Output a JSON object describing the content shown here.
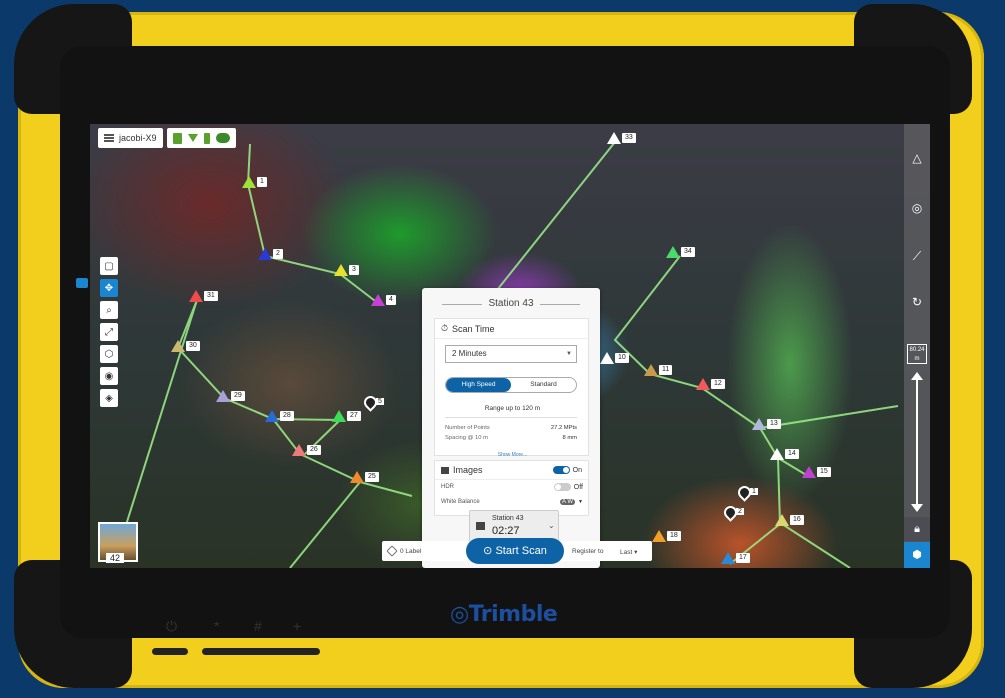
{
  "header": {
    "device_name": "jacobi-X9"
  },
  "map": {
    "stations": [
      {
        "id": "1",
        "color": "#9be33a"
      },
      {
        "id": "2",
        "color": "#2a3ad8"
      },
      {
        "id": "3",
        "color": "#e8e030"
      },
      {
        "id": "4",
        "color": "#c640d6"
      },
      {
        "id": "31",
        "color": "#f04a4a"
      },
      {
        "id": "30",
        "color": "#c8b870"
      },
      {
        "id": "29",
        "color": "#a8a0d8"
      },
      {
        "id": "28",
        "color": "#2a6ad8"
      },
      {
        "id": "27",
        "color": "#3adc5a"
      },
      {
        "id": "26",
        "color": "#f07a7a"
      },
      {
        "id": "25",
        "color": "#f08a2a"
      },
      {
        "id": "33",
        "color": "#ffffff"
      },
      {
        "id": "34",
        "color": "#4adc6a"
      },
      {
        "id": "10",
        "color": "#ffffff"
      },
      {
        "id": "11",
        "color": "#c89a4a"
      },
      {
        "id": "12",
        "color": "#f05a5a"
      },
      {
        "id": "13",
        "color": "#b0b8d8"
      },
      {
        "id": "14",
        "color": "#ffffff"
      },
      {
        "id": "15",
        "color": "#c040d0"
      },
      {
        "id": "16",
        "color": "#d8d870"
      },
      {
        "id": "17",
        "color": "#2a8ad8"
      },
      {
        "id": "18",
        "color": "#f0a02a"
      }
    ],
    "pins": [
      {
        "id": "5"
      },
      {
        "id": "1"
      },
      {
        "id": "2"
      }
    ],
    "thumbnail_station": "42"
  },
  "scan_card": {
    "title": "Station 43",
    "scan_time_label": "Scan Time",
    "scan_time_value": "2 Minutes",
    "mode_high": "High Speed",
    "mode_standard": "Standard",
    "range_text": "Range up to 120 m",
    "num_points_label": "Number of Points",
    "num_points_value": "27.2 MPts",
    "spacing_label": "Spacing @ 10 m",
    "spacing_value": "8 mm",
    "show_more": "Show More...",
    "images_label": "Images",
    "images_state": "On",
    "hdr_label": "HDR",
    "hdr_state": "Off",
    "white_balance_label": "White Balance",
    "white_balance_value": "A W"
  },
  "timer": {
    "station_label": "Station 43",
    "time": "02:27"
  },
  "bottom_bar": {
    "label_count": "0 Label",
    "start_scan": "Start Scan",
    "register_to": "Register to",
    "register_value": "Last"
  },
  "right_panel": {
    "scale_value": "80.24",
    "scale_unit": "m"
  },
  "device": {
    "brand": "Trimble",
    "keys": [
      "⏻",
      "*",
      "#",
      "+"
    ]
  },
  "colors": {
    "accent_blue": "#0d63a5",
    "case_yellow": "#f2cf1d",
    "background_navy": "#0b3a6a"
  }
}
